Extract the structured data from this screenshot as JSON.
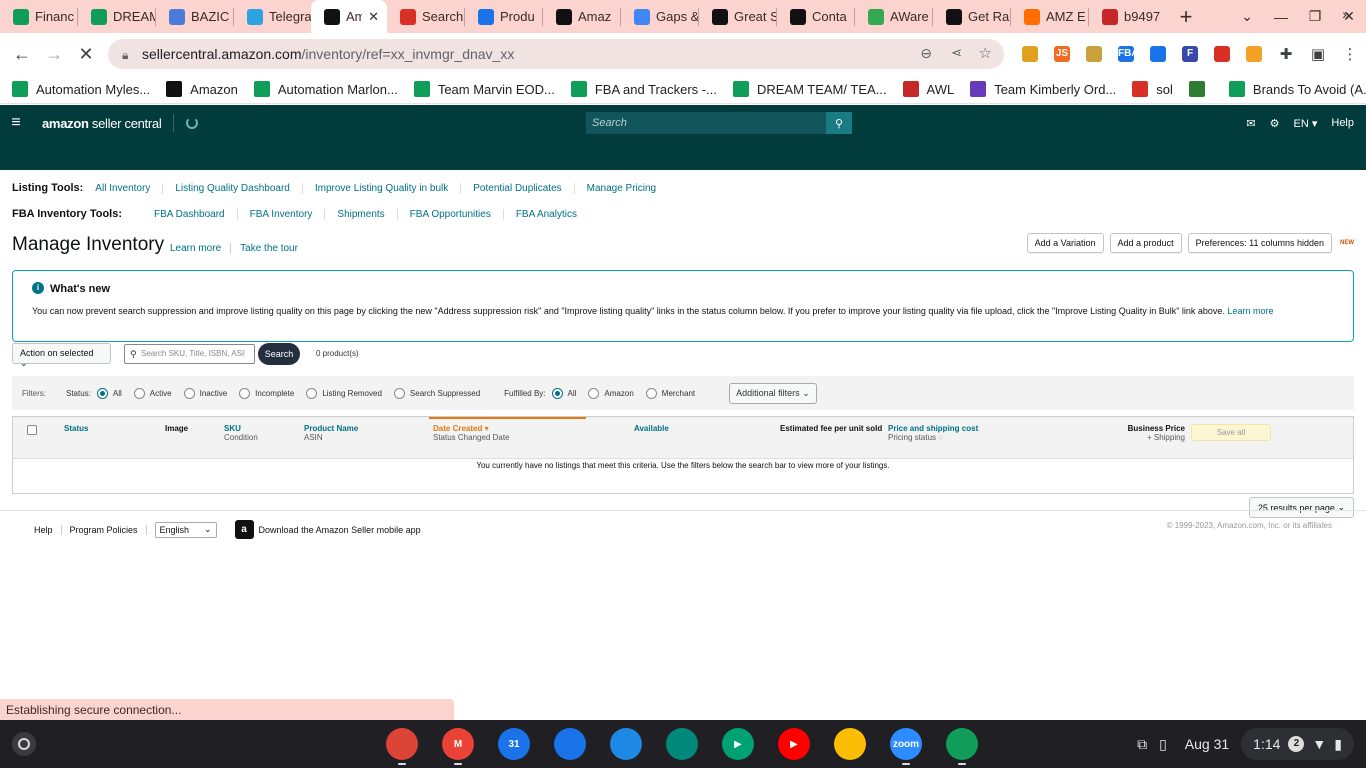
{
  "browser": {
    "tabs": [
      {
        "title": "Financ",
        "icon": "sheets-icon",
        "color": "#0f9d58"
      },
      {
        "title": "DREAM",
        "icon": "sheets-icon",
        "color": "#0f9d58"
      },
      {
        "title": "BAZIC",
        "icon": "grid-icon",
        "color": "#4b7bd8"
      },
      {
        "title": "Telegra",
        "icon": "telegram-icon",
        "color": "#2aa3e0"
      },
      {
        "title": "Am",
        "icon": "amazon-icon",
        "color": "#111111",
        "active": true
      },
      {
        "title": "Search",
        "icon": "gmail-icon",
        "color": "#d93025"
      },
      {
        "title": "Produ",
        "icon": "circle-grid-icon",
        "color": "#1a73e8"
      },
      {
        "title": "Amaz",
        "icon": "amazon-icon",
        "color": "#111111"
      },
      {
        "title": "Gaps &",
        "icon": "google-icon",
        "color": "#4285f4"
      },
      {
        "title": "Great S",
        "icon": "a-logo-icon",
        "color": "#111111"
      },
      {
        "title": "Conta",
        "icon": "a-logo-icon",
        "color": "#111111"
      },
      {
        "title": "AWare",
        "icon": "maps-icon",
        "color": "#34a853"
      },
      {
        "title": "Get Ra",
        "icon": "black-square-icon",
        "color": "#111111"
      },
      {
        "title": "AMZ E",
        "icon": "stripe-icon",
        "color": "#ff6d00"
      },
      {
        "title": "b9497",
        "icon": "flag-icon",
        "color": "#c62828"
      }
    ],
    "url_host": "sellercentral.amazon.com",
    "url_path": "/inventory/ref=xx_invmgr_dnav_xx",
    "extensions": [
      {
        "name": "bee-extension-icon",
        "color": "#e0a020",
        "label": ""
      },
      {
        "name": "js-extension-icon",
        "color": "#f26b21",
        "label": "JS"
      },
      {
        "name": "sync-extension-icon",
        "color": "#c9a13b",
        "label": ""
      },
      {
        "name": "fba-extension-icon",
        "color": "#1a73e8",
        "label": "FBA"
      },
      {
        "name": "circle-extension-icon",
        "color": "#1a73e8",
        "label": ""
      },
      {
        "name": "f-extension-icon",
        "color": "#3949ab",
        "label": "F"
      },
      {
        "name": "lasso-extension-icon",
        "color": "#d93025",
        "label": ""
      },
      {
        "name": "orange-circle-extension-icon",
        "color": "#f4a026",
        "label": ""
      }
    ]
  },
  "bookmarks": [
    {
      "label": "Automation Myles...",
      "icon": "sheets-icon",
      "color": "#0f9d58"
    },
    {
      "label": "Amazon",
      "icon": "amazon-icon",
      "color": "#111111"
    },
    {
      "label": "Automation Marlon...",
      "icon": "sheets-icon",
      "color": "#0f9d58"
    },
    {
      "label": "Team Marvin EOD...",
      "icon": "sheets-icon",
      "color": "#0f9d58"
    },
    {
      "label": "FBA and Trackers -...",
      "icon": "sheets-icon",
      "color": "#0f9d58"
    },
    {
      "label": "DREAM TEAM/ TEA...",
      "icon": "sheets-icon",
      "color": "#0f9d58"
    },
    {
      "label": "AWL",
      "icon": "awl-icon",
      "color": "#c62828"
    },
    {
      "label": "Team Kimberly Ord...",
      "icon": "forms-icon",
      "color": "#673ab7"
    },
    {
      "label": "sol",
      "icon": "gmail-icon",
      "color": "#d93025"
    },
    {
      "label": "",
      "icon": "n-logo-icon",
      "color": "#2e7d32"
    },
    {
      "label": "Brands To Avoid (A...",
      "icon": "sheets-icon",
      "color": "#0f9d58"
    }
  ],
  "header": {
    "logo_bold": "amazon",
    "logo_rest": " seller central",
    "search_placeholder": "Search",
    "lang": "EN",
    "help": "Help"
  },
  "listing_tools": {
    "label": "Listing Tools:",
    "links": [
      "All Inventory",
      "Listing Quality Dashboard",
      "Improve Listing Quality in bulk",
      "Potential Duplicates",
      "Manage Pricing"
    ]
  },
  "fba_tools": {
    "label": "FBA Inventory Tools:",
    "links": [
      "FBA Dashboard",
      "FBA Inventory",
      "Shipments",
      "FBA Opportunities",
      "FBA Analytics"
    ]
  },
  "page": {
    "title": "Manage Inventory",
    "learn_more": "Learn more",
    "take_tour": "Take the tour",
    "add_variation": "Add a Variation",
    "add_product": "Add a product",
    "preferences": "Preferences: 11 columns hidden",
    "new_badge": "NEW"
  },
  "alert": {
    "title": "What's new",
    "body": "You can now prevent search suppression and improve listing quality on this page by clicking the new \"Address suppression risk\" and \"Improve listing quality\" links in the status column below. If you prefer to improve your listing quality via file upload, click the \"Improve Listing Quality in Bulk\" link above. ",
    "link": "Learn more"
  },
  "actions": {
    "action_select": "Action on selected",
    "search_placeholder": "Search SKU, Title, ISBN, ASIN",
    "search_btn": "Search",
    "count": "0 product(s)"
  },
  "filters": {
    "label": "Filters:",
    "status_label": "Status:",
    "status_options": [
      "All",
      "Active",
      "Inactive",
      "Incomplete",
      "Listing Removed",
      "Search Suppressed"
    ],
    "fulfilled_label": "Fulfilled By:",
    "fulfilled_options": [
      "All",
      "Amazon",
      "Merchant"
    ],
    "additional": "Additional filters"
  },
  "table": {
    "status": "Status",
    "image": "Image",
    "sku": "SKU",
    "condition": "Condition",
    "product_name": "Product Name",
    "asin": "ASIN",
    "date_created": "Date Created",
    "status_changed": "Status Changed Date",
    "available": "Available",
    "est_fee": "Estimated fee per unit sold",
    "price_ship": "Price and shipping cost",
    "pricing_status": "Pricing status",
    "business_price": "Business Price",
    "plus_shipping": "+ Shipping",
    "save_all": "Save all",
    "empty_msg": "You currently have no listings that meet this criteria. Use the filters below the search bar to view more of your listings."
  },
  "per_page": "25 results per page",
  "footer": {
    "help": "Help",
    "program_policies": "Program Policies",
    "language": "English",
    "download_app": "Download the Amazon Seller mobile app",
    "copyright": "© 1999-2023, Amazon.com, Inc. or its affiliates"
  },
  "status_bubble": "Establishing secure connection...",
  "shelf": {
    "apps": [
      {
        "name": "chrome-icon",
        "color": "#db4437",
        "label": "",
        "running": true
      },
      {
        "name": "gmail-icon",
        "color": "#ea4335",
        "label": "M",
        "running": true
      },
      {
        "name": "calendar-icon",
        "color": "#1a73e8",
        "label": "31",
        "running": false
      },
      {
        "name": "files-icon",
        "color": "#1a73e8",
        "label": "",
        "running": false
      },
      {
        "name": "chat-icon",
        "color": "#1e88e5",
        "label": "",
        "running": false
      },
      {
        "name": "meet-icon",
        "color": "#00897b",
        "label": "",
        "running": false
      },
      {
        "name": "play-store-icon",
        "color": "#00a173",
        "label": "▶",
        "running": false
      },
      {
        "name": "youtube-icon",
        "color": "#ff0000",
        "label": "▶",
        "running": false
      },
      {
        "name": "photos-icon",
        "color": "#fbbc04",
        "label": "",
        "running": false
      },
      {
        "name": "zoom-icon",
        "color": "#2d8cff",
        "label": "zoom",
        "running": true
      },
      {
        "name": "sheets-calc-icon",
        "color": "#0f9d58",
        "label": "",
        "running": true
      }
    ],
    "date": "Aug 31",
    "time": "1:14",
    "notif_count": "2"
  }
}
